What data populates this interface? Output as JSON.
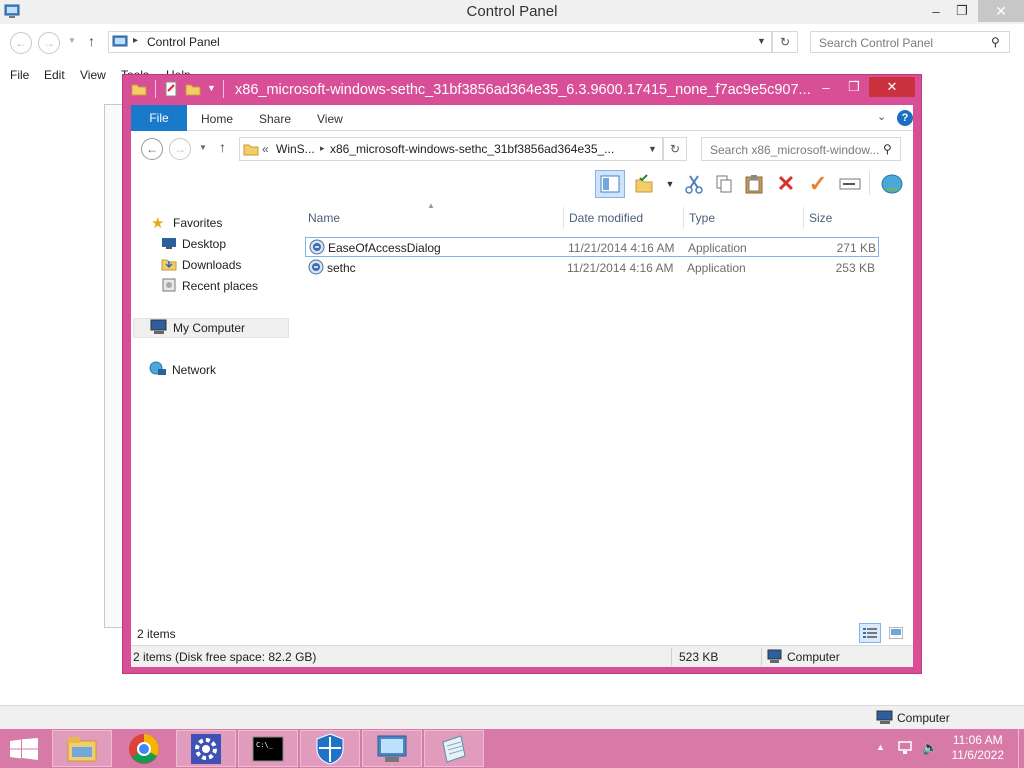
{
  "control_panel": {
    "title": "Control Panel",
    "address": "Control Panel",
    "search_placeholder": "Search Control Panel",
    "menu": [
      "File",
      "Edit",
      "View",
      "Tools",
      "Help"
    ],
    "status_location": "Computer"
  },
  "explorer": {
    "title": "x86_microsoft-windows-sethc_31bf3856ad364e35_6.3.9600.17415_none_f7ac9e5c907...",
    "ribbon_tabs": {
      "file": "File",
      "home": "Home",
      "share": "Share",
      "view": "View"
    },
    "address": {
      "prefix": "«",
      "parent": "WinS...",
      "current": "x86_microsoft-windows-sethc_31bf3856ad364e35_..."
    },
    "search_placeholder": "Search x86_microsoft-window...",
    "nav": {
      "favorites": "Favorites",
      "desktop": "Desktop",
      "downloads": "Downloads",
      "recent": "Recent places",
      "computer": "My Computer",
      "network": "Network"
    },
    "columns": {
      "name": "Name",
      "date": "Date modified",
      "type": "Type",
      "size": "Size"
    },
    "files": [
      {
        "name": "EaseOfAccessDialog",
        "date": "11/21/2014 4:16 AM",
        "type": "Application",
        "size": "271 KB"
      },
      {
        "name": "sethc",
        "date": "11/21/2014 4:16 AM",
        "type": "Application",
        "size": "253 KB"
      }
    ],
    "item_count": "2 items",
    "status": {
      "summary": "2 items (Disk free space: 82.2 GB)",
      "size": "523 KB",
      "location": "Computer"
    }
  },
  "taskbar": {
    "time": "11:06 AM",
    "date": "11/6/2022"
  },
  "colors": {
    "accent": "#d94f97",
    "taskbar": "#d77aa7",
    "file_tab": "#1979ca",
    "close": "#c9323c"
  }
}
